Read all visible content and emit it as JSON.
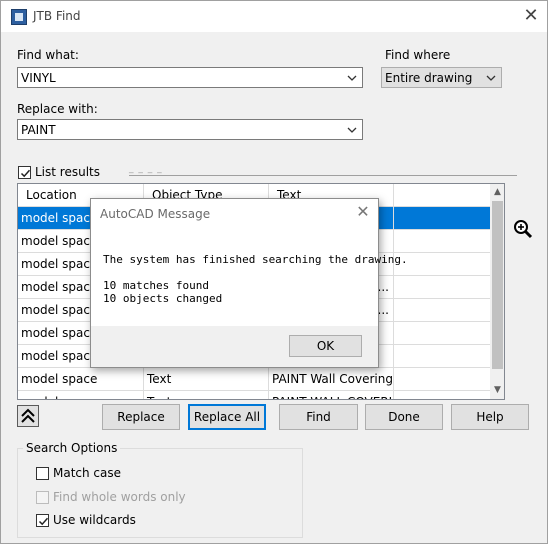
{
  "window": {
    "title": "JTB Find",
    "close_glyph": "✕"
  },
  "find_what": {
    "label": "Find what:",
    "value": "VINYL"
  },
  "replace_with": {
    "label": "Replace with:",
    "value": "PAINT"
  },
  "find_where": {
    "label": "Find where",
    "value": "Entire drawing"
  },
  "list_results": {
    "label": "List results",
    "checked": true
  },
  "results_table": {
    "columns": [
      "Location",
      "Object Type",
      "Text"
    ],
    "rows": [
      [
        "model space",
        "",
        ""
      ],
      [
        "model space",
        "",
        ""
      ],
      [
        "model space",
        "",
        ""
      ],
      [
        "model space",
        "",
        "..."
      ],
      [
        "model space",
        "",
        "..."
      ],
      [
        "model space",
        "",
        ""
      ],
      [
        "model space",
        "",
        ""
      ],
      [
        "model space",
        "Text",
        "PAINT Wall Covering"
      ],
      [
        "model space",
        "Text",
        "PAINT WALL COVERI..."
      ]
    ],
    "visible_fragments": [
      "e",
      "e"
    ],
    "selected_row": 0
  },
  "buttons": {
    "replace": "Replace",
    "replace_all": "Replace All",
    "find": "Find",
    "done": "Done",
    "help": "Help"
  },
  "search_options": {
    "title": "Search Options",
    "match_case": {
      "label": "Match case",
      "checked": false
    },
    "whole_words": {
      "label": "Find whole words only",
      "checked": false,
      "enabled": false
    },
    "use_wildcards": {
      "label": "Use wildcards",
      "checked": true
    }
  },
  "message_box": {
    "title": "AutoCAD Message",
    "line1": "The system has finished searching the drawing.",
    "line2": "10 matches found",
    "line3": "10 objects changed",
    "ok_label": "OK",
    "close_glyph": "✕"
  },
  "icons": {
    "app": "app-icon",
    "zoom": "zoom-magnifier-icon",
    "collapse": "double-chevron-up-icon",
    "dropdown": "chevron-down-icon"
  },
  "colors": {
    "selection": "#0078d7",
    "default_button_border": "#0078d7"
  }
}
